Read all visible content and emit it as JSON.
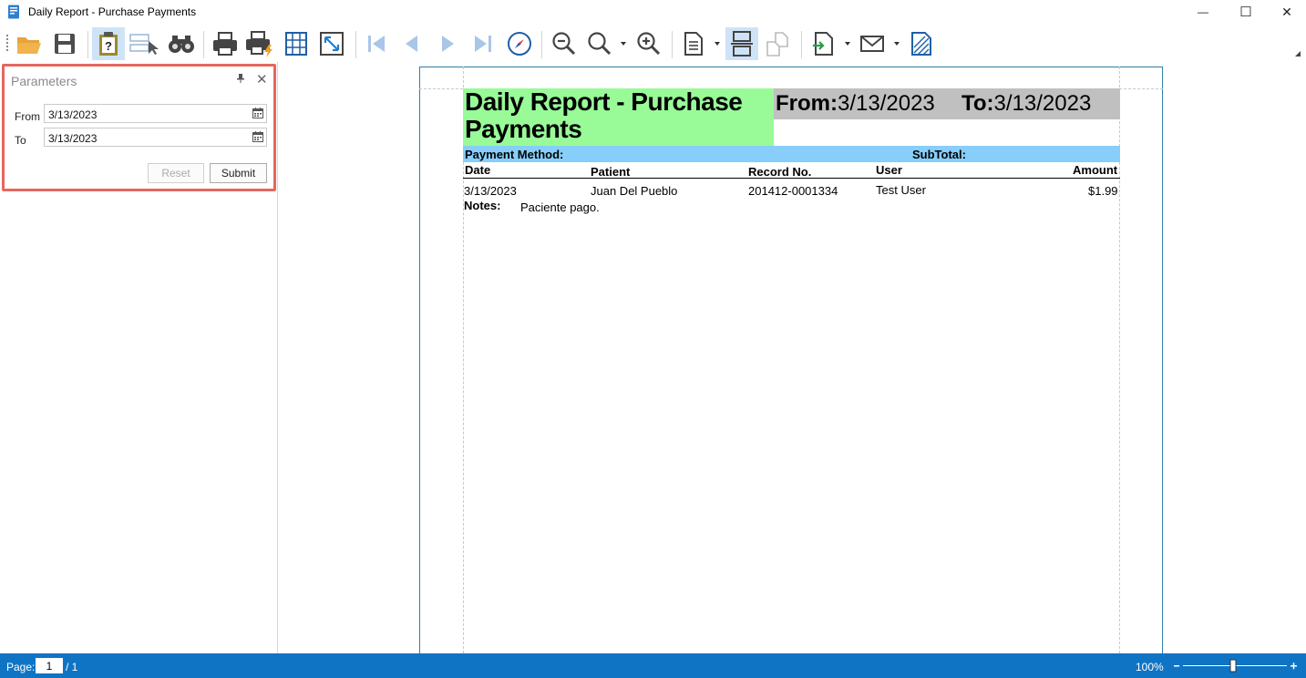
{
  "window": {
    "title": "Daily Report - Purchase Payments",
    "min_glyph": "—",
    "max_glyph": "☐",
    "close_glyph": "✕"
  },
  "toolbar": {
    "items": [
      "open-icon",
      "save-icon",
      "parameters-icon",
      "editing-fields-icon",
      "search-icon",
      "print-icon",
      "quick-print-icon",
      "page-setup-icon",
      "scale-icon",
      "first-page-icon",
      "previous-page-icon",
      "next-page-icon",
      "last-page-icon",
      "navigation-pane-icon",
      "zoom-out-icon",
      "zoom-icon",
      "zoom-in-icon",
      "single-page-icon",
      "multipage-icon",
      "export-icon",
      "send-email-icon",
      "watermark-icon"
    ]
  },
  "parameters": {
    "title": "Parameters",
    "from_label": "From",
    "from_value": "3/13/2023",
    "to_label": "To",
    "to_value": "3/13/2023",
    "reset_label": "Reset",
    "submit_label": "Submit"
  },
  "report": {
    "title_line1": "Daily Report - Purchase",
    "title_line2": "Payments",
    "from_label": "From:",
    "from_value": "3/13/2023",
    "to_label": "To:",
    "to_value": "3/13/2023",
    "payment_method_label": "Payment Method:",
    "subtotal_label": "SubTotal:",
    "columns": {
      "date": "Date",
      "patient": "Patient",
      "record": "Record No.",
      "user": "User",
      "amount": "Amount"
    },
    "rows": [
      {
        "date": "3/13/2023",
        "patient": "Juan Del Pueblo",
        "record": "201412-0001334",
        "user": "Test User",
        "amount": "$1.99",
        "notes_label": "Notes:",
        "notes": "Paciente pago."
      }
    ]
  },
  "statusbar": {
    "page_label": "Page:",
    "page_value": "1",
    "page_total": "/ 1",
    "zoom": "100%"
  },
  "colors": {
    "title_band": "#98fb98",
    "date_band": "#c0c0c0",
    "header_band": "#87cefa",
    "statusbar": "#1074c4",
    "highlight": "#e3685f"
  }
}
